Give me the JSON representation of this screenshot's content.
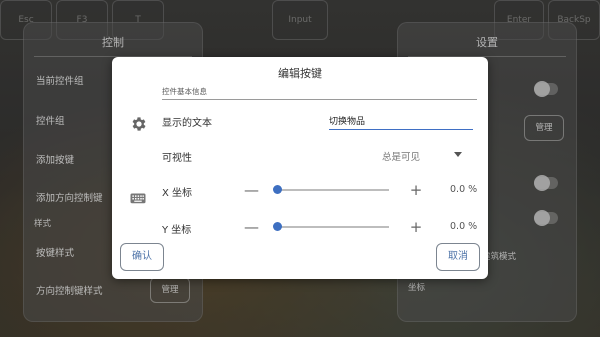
{
  "background": {
    "top_keys": [
      "Esc",
      "F3",
      "T",
      "Input",
      "Enter",
      "BackSp"
    ],
    "left_panel": {
      "title": "控制",
      "items": [
        "当前控件组",
        "控件组",
        "添加按键",
        "添加方向控制键"
      ],
      "section_label": "样式",
      "style_items": [
        "按键样式",
        "方向控制键样式"
      ],
      "manage_button": "管理"
    },
    "right_panel": {
      "title": "设置",
      "manage_button": "管理",
      "partial_text": "建筑模式",
      "partial_label": "坐标"
    }
  },
  "dialog": {
    "title": "编辑按键",
    "section_label": "控件基本信息",
    "display_text_label": "显示的文本",
    "display_text_value": "切换物品",
    "visibility_label": "可视性",
    "visibility_value": "总是可见",
    "x_label": "X 坐标",
    "x_value_text": "0.0 %",
    "x_value": 0,
    "y_label": "Y 坐标",
    "y_value_text": "0.0 %",
    "y_value": 0,
    "minus_symbol": "—",
    "plus_symbol": "+",
    "confirm_button": "确认",
    "cancel_button": "取消"
  },
  "colors": {
    "accent": "#3d6fc1",
    "button_text": "#4d73a8"
  }
}
